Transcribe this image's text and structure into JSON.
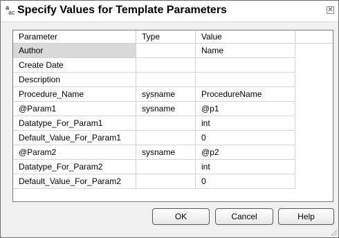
{
  "dialog": {
    "title": "Specify Values for Template Parameters",
    "icon_glyph_top": "a",
    "icon_glyph_bottom": "ac",
    "close_glyph": "✕"
  },
  "grid": {
    "columns": [
      "Parameter",
      "Type",
      "Value"
    ],
    "rows": [
      {
        "parameter": "Author",
        "type": "",
        "value": "Name",
        "selected": true
      },
      {
        "parameter": "Create Date",
        "type": "",
        "value": ""
      },
      {
        "parameter": "Description",
        "type": "",
        "value": ""
      },
      {
        "parameter": "Procedure_Name",
        "type": "sysname",
        "value": "ProcedureName"
      },
      {
        "parameter": "@Param1",
        "type": "sysname",
        "value": "@p1"
      },
      {
        "parameter": "Datatype_For_Param1",
        "type": "",
        "value": "int"
      },
      {
        "parameter": "Default_Value_For_Param1",
        "type": "",
        "value": "0"
      },
      {
        "parameter": "@Param2",
        "type": "sysname",
        "value": "@p2"
      },
      {
        "parameter": "Datatype_For_Param2",
        "type": "",
        "value": "int"
      },
      {
        "parameter": "Default_Value_For_Param2",
        "type": "",
        "value": "0"
      }
    ]
  },
  "buttons": {
    "ok": "OK",
    "cancel": "Cancel",
    "help": "Help"
  }
}
